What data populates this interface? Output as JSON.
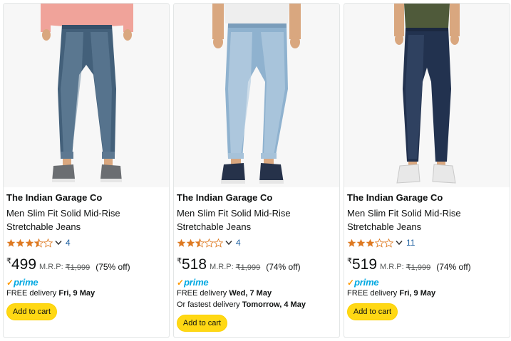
{
  "colors": {
    "accent_button": "#ffd814",
    "star": "#de7921",
    "link": "#2162a1",
    "prime_blue": "#00a8e1",
    "prime_check": "#ff9900"
  },
  "products": [
    {
      "brand": "The Indian Garage Co",
      "title": "Men Slim Fit Solid Mid-Rise Stretchable Jeans",
      "rating": 3.5,
      "rating_count": "4",
      "currency": "₹",
      "price": "499",
      "mrp_label": "M.R.P:",
      "mrp": "₹1,999",
      "discount": "(75% off)",
      "prime_check": "✓",
      "prime_label": "prime",
      "delivery_prefix": "FREE delivery",
      "delivery_date": "Fri, 9 May",
      "add_to_cart": "Add to cart",
      "image_icon": "jeans-product-image"
    },
    {
      "brand": "The Indian Garage Co",
      "title": "Men Slim Fit Solid Mid-Rise Stretchable Jeans",
      "rating": 2.5,
      "rating_count": "4",
      "currency": "₹",
      "price": "518",
      "mrp_label": "M.R.P:",
      "mrp": "₹1,999",
      "discount": "(74% off)",
      "prime_check": "✓",
      "prime_label": "prime",
      "delivery_prefix": "FREE delivery",
      "delivery_date": "Wed, 7 May",
      "fastest_prefix": "Or fastest delivery",
      "fastest_date": "Tomorrow, 4 May",
      "add_to_cart": "Add to cart",
      "image_icon": "jeans-product-image"
    },
    {
      "brand": "The Indian Garage Co",
      "title": "Men Slim Fit Solid Mid-Rise Stretchable Jeans",
      "rating": 3,
      "rating_count": "11",
      "currency": "₹",
      "price": "519",
      "mrp_label": "M.R.P:",
      "mrp": "₹1,999",
      "discount": "(74% off)",
      "prime_check": "✓",
      "prime_label": "prime",
      "delivery_prefix": "FREE delivery",
      "delivery_date": "Fri, 9 May",
      "add_to_cart": "Add to cart",
      "image_icon": "jeans-product-image"
    }
  ]
}
